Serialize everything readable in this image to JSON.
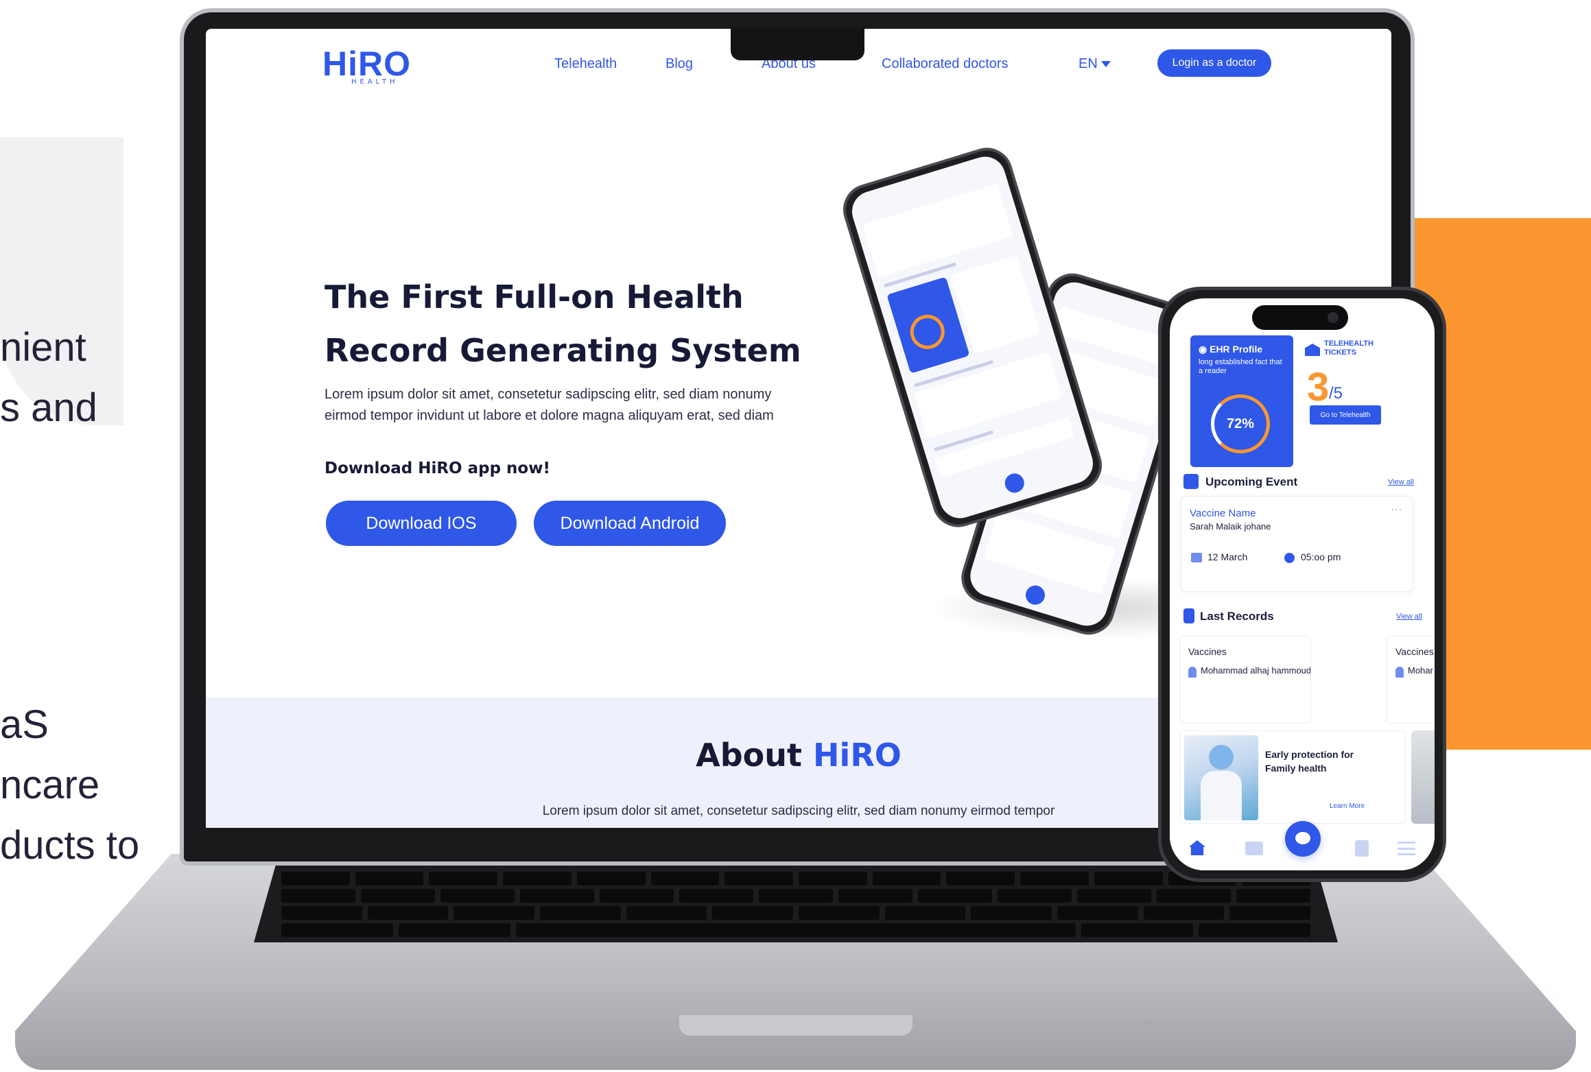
{
  "side_text": {
    "line1": "nient",
    "line2": "s and",
    "line3": "aS",
    "line4": "ncare",
    "line5": "ducts to"
  },
  "colors": {
    "brand_blue": "#2f57e8",
    "accent_orange": "#fb9630",
    "text_dark": "#161a36",
    "about_band": "#eef1fc"
  },
  "website": {
    "logo": "HiRO",
    "logo_sub": "HEALTH",
    "nav": {
      "items": [
        "Telehealth",
        "Blog",
        "About us",
        "Collaborated doctors"
      ],
      "language": "EN",
      "login_button": "Login as a doctor"
    },
    "hero": {
      "title_line1": "The First Full-on Health",
      "title_line2": "Record Generating System",
      "description_line1": "Lorem ipsum dolor sit amet, consetetur sadipscing elitr, sed diam nonumy",
      "description_line2": "eirmod tempor invidunt ut labore et dolore magna aliquyam erat, sed diam",
      "download_label": "Download HiRO app now!",
      "download_ios": "Download IOS",
      "download_android": "Download Android"
    },
    "about": {
      "title_prefix": "About",
      "title_brand": "HiRO",
      "description": "Lorem ipsum dolor sit amet, consetetur sadipscing elitr, sed diam nonumy eirmod tempor"
    }
  },
  "phone_app": {
    "ehr": {
      "title": "EHR Profile",
      "description": "long established fact that a reader",
      "progress_label": "72%",
      "progress_value": 0.72
    },
    "tickets": {
      "title": "TELEHEALTH TICKETS",
      "count": "3",
      "total": "/5",
      "button": "Go to Telehealth"
    },
    "upcoming": {
      "title": "Upcoming Event",
      "view_all": "View all",
      "event_name": "Vaccine Name",
      "person": "Sarah Malaik johane",
      "date": "12 March",
      "time": "05:oo pm",
      "more": "···"
    },
    "records": {
      "title": "Last Records",
      "view_all": "View all",
      "items": [
        {
          "type": "Vaccines",
          "name": "Mohammad alhaj hammoud"
        },
        {
          "type": "Vaccines",
          "name": "Mohar"
        }
      ]
    },
    "promo": {
      "title": "Early protection for Family health",
      "link": "Learn More"
    }
  }
}
